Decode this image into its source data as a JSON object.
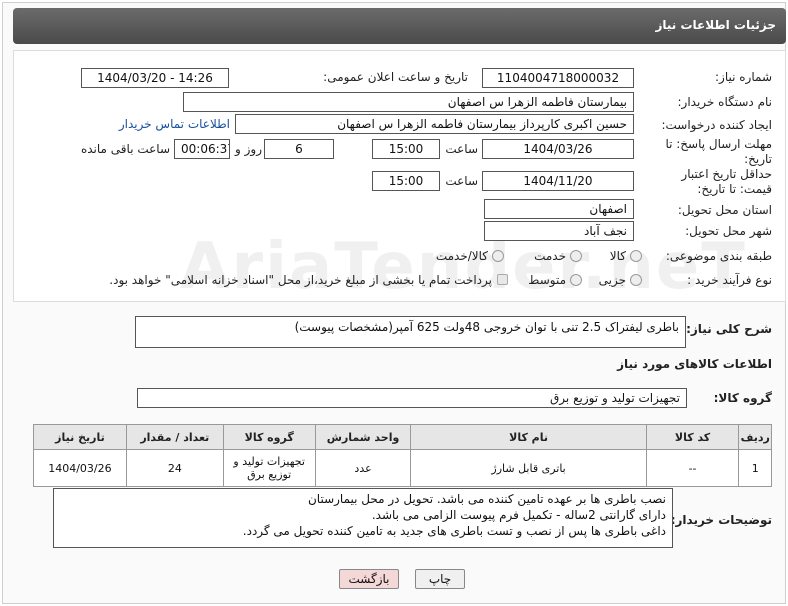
{
  "title": "جزئیات اطلاعات نیاز",
  "fields": {
    "need_number_label": "شماره نیاز:",
    "need_number": "1104004718000032",
    "announce_label": "تاریخ و ساعت اعلان عمومی:",
    "announce_value": "1404/03/20 - 14:26",
    "buyer_org_label": "نام دستگاه خریدار:",
    "buyer_org": "بیمارستان فاطمه الزهرا س  اصفهان",
    "creator_label": "ایجاد کننده درخواست:",
    "creator": "حسین اکبری کارپرداز بیمارستان فاطمه الزهرا س  اصفهان",
    "contact_link": "اطلاعات تماس خریدار",
    "deadline_label": "مهلت ارسال پاسخ: تا تاریخ:",
    "deadline_date": "1404/03/26",
    "time_label": "ساعت",
    "deadline_time": "15:00",
    "days_value": "6",
    "days_label": "روز و",
    "remaining_time": "00:06:37",
    "remaining_label": "ساعت باقی مانده",
    "price_validity_label": "حداقل تاریخ اعتبار قیمت: تا تاریخ:",
    "price_validity_date": "1404/11/20",
    "price_validity_time": "15:00",
    "province_label": "استان محل تحویل:",
    "province": "اصفهان",
    "city_label": "شهر محل تحویل:",
    "city": "نجف آباد",
    "category_label": "طبقه بندی موضوعی:",
    "category_options": [
      "کالا",
      "خدمت",
      "کالا/خدمت"
    ],
    "process_label": "نوع فرآیند خرید :",
    "process_options": [
      "جزیی",
      "متوسط"
    ],
    "payment_note": "پرداخت تمام یا بخشی از مبلغ خرید،از محل \"اسناد خزانه اسلامی\" خواهد بود."
  },
  "description": {
    "label": "شرح کلی نیاز:",
    "text": "باطری لیفتراک 2.5 تنی با توان خروجی 48ولت 625 آمپر(مشخصات پیوست)"
  },
  "goods_info_title": "اطلاعات کالاهای مورد نیاز",
  "goods_group": {
    "label": "گروه کالا:",
    "value": "تجهیزات تولید و توزیع برق"
  },
  "table": {
    "headers": [
      "ردیف",
      "کد کالا",
      "نام کالا",
      "واحد شمارش",
      "گروه کالا",
      "تعداد / مقدار",
      "تاریخ نیاز"
    ],
    "rows": [
      [
        "1",
        "--",
        "باتری قابل شارژ",
        "عدد",
        "تجهیزات تولید و توزیع برق",
        "24",
        "1404/03/26"
      ]
    ]
  },
  "buyer_notes": {
    "label": "توضیحات خریدار:",
    "lines": [
      "نصب باطری ها بر عهده تامین کننده می باشد. تحویل در محل بیمارستان",
      "دارای گارانتی 2ساله - تکمیل فرم پیوست الزامی می باشد.",
      "داغی باطری ها پس از نصب و تست باطری های جدید به تامین کننده تحویل می گردد."
    ]
  },
  "buttons": {
    "print": "چاپ",
    "back": "بازگشت"
  },
  "watermark": "AriaTender.neT",
  "colors": {
    "title_bar": "#595959",
    "back_button": "#f4d7d7",
    "print_button": "#f0f0f0"
  }
}
